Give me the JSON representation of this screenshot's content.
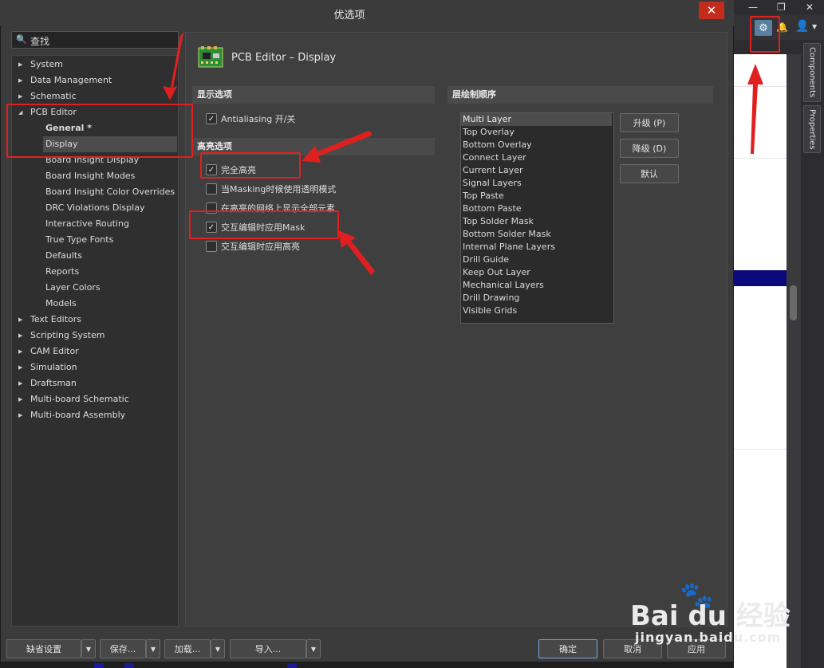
{
  "window": {
    "title": "优选项",
    "close_glyph": "✕",
    "minimize_glyph": "—",
    "restore_glyph": "❐",
    "app_close_glyph": "✕"
  },
  "right_panel": {
    "gear_icon": "gear-icon",
    "gear_glyph": "⚙",
    "bell_glyph": "🔔",
    "user_glyph": "👤",
    "caret_glyph": "▼",
    "tabs": [
      "Components",
      "Properties"
    ]
  },
  "search": {
    "label": "查找",
    "glyph": "🔍"
  },
  "tree": [
    {
      "label": "System",
      "level": 0,
      "arrow": "▶"
    },
    {
      "label": "Data Management",
      "level": 0,
      "arrow": "▶"
    },
    {
      "label": "Schematic",
      "level": 0,
      "arrow": "▶"
    },
    {
      "label": "PCB Editor",
      "level": 0,
      "arrow": "◢"
    },
    {
      "label": "General *",
      "level": 1,
      "bold": true
    },
    {
      "label": "Display",
      "level": 1,
      "selected": true
    },
    {
      "label": "Board Insight Display",
      "level": 1
    },
    {
      "label": "Board Insight Modes",
      "level": 1
    },
    {
      "label": "Board Insight Color Overrides",
      "level": 1
    },
    {
      "label": "DRC Violations Display",
      "level": 1
    },
    {
      "label": "Interactive Routing",
      "level": 1
    },
    {
      "label": "True Type Fonts",
      "level": 1
    },
    {
      "label": "Defaults",
      "level": 1
    },
    {
      "label": "Reports",
      "level": 1
    },
    {
      "label": "Layer Colors",
      "level": 1
    },
    {
      "label": "Models",
      "level": 1
    },
    {
      "label": "Text Editors",
      "level": 0,
      "arrow": "▶"
    },
    {
      "label": "Scripting System",
      "level": 0,
      "arrow": "▶"
    },
    {
      "label": "CAM Editor",
      "level": 0,
      "arrow": "▶"
    },
    {
      "label": "Simulation",
      "level": 0,
      "arrow": "▶"
    },
    {
      "label": "Draftsman",
      "level": 0,
      "arrow": "▶"
    },
    {
      "label": "Multi-board Schematic",
      "level": 0,
      "arrow": "▶"
    },
    {
      "label": "Multi-board Assembly",
      "level": 0,
      "arrow": "▶"
    }
  ],
  "page": {
    "title": "PCB Editor – Display"
  },
  "display_options": {
    "header": "显示选项",
    "items": [
      {
        "label": "Antialiasing 开/关",
        "checked": true
      }
    ]
  },
  "highlight_options": {
    "header": "高亮选项",
    "items": [
      {
        "label": "完全高亮",
        "checked": true
      },
      {
        "label": "当Masking时候使用透明模式",
        "checked": false
      },
      {
        "label": "在高亮的网络上显示全部元素",
        "checked": false
      },
      {
        "label": "交互编辑时应用Mask",
        "checked": true
      },
      {
        "label": "交互编辑时应用高亮",
        "checked": false
      }
    ]
  },
  "check_glyph": "✓",
  "layer_order": {
    "header": "层绘制顺序",
    "layers": [
      "Multi Layer",
      "Top Overlay",
      "Bottom Overlay",
      "Connect Layer",
      "Current Layer",
      "Signal Layers",
      "Top Paste",
      "Bottom Paste",
      "Top Solder Mask",
      "Bottom Solder Mask",
      "Internal Plane Layers",
      "Drill Guide",
      "Keep Out Layer",
      "Mechanical Layers",
      "Drill Drawing",
      "Visible Grids"
    ],
    "selected_index": 0,
    "buttons": {
      "up": "升级 (P)",
      "down": "降级 (D)",
      "default": "默认"
    }
  },
  "footer": {
    "defaults": "缺省设置",
    "save": "保存...",
    "load": "加载...",
    "import": "导入...",
    "drop_glyph": "▼",
    "ok": "确定",
    "cancel": "取消",
    "apply": "应用"
  },
  "watermark": {
    "brand": "Bai  du 经验",
    "site": "jingyan.baidu.com",
    "paw_glyph": "🐾"
  },
  "colors": {
    "accent_red": "#e02020",
    "gear_bg": "#5a7fa0",
    "close_red": "#c42b1c"
  }
}
